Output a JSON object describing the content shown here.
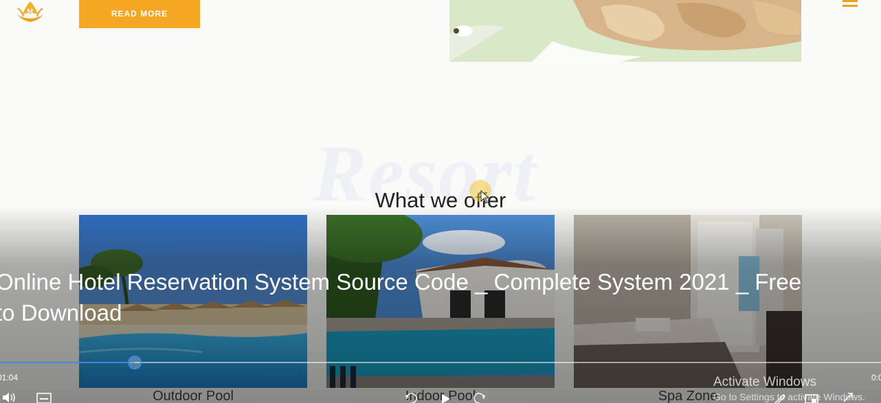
{
  "site": {
    "read_more_label": "READ MORE",
    "watermark": "Resort",
    "section_title": "What we offer",
    "cards": [
      {
        "caption": "Outdoor Pool"
      },
      {
        "caption": "Indoor Pool"
      },
      {
        "caption": "Spa Zone"
      }
    ],
    "icons": {
      "logo": "crown-logo",
      "menu": "hamburger-menu-icon"
    },
    "colors": {
      "accent": "#f5a623",
      "heading": "#222222"
    }
  },
  "player": {
    "title": "Online Hotel Reservation System Source Code _ Complete System 2021 _ Free to Download",
    "time_current": "01:04",
    "time_total": "0:0",
    "progress": 0.153,
    "colors": {
      "progress": "#3d8be0"
    },
    "controls": [
      "volume-icon",
      "captions-icon",
      "rewind-10-icon",
      "play-icon",
      "forward-30-icon",
      "edit-icon",
      "mini-player-icon",
      "fullscreen-icon"
    ]
  },
  "windows_watermark": {
    "title": "Activate Windows",
    "subtitle": "Go to Settings to activate Windows."
  }
}
